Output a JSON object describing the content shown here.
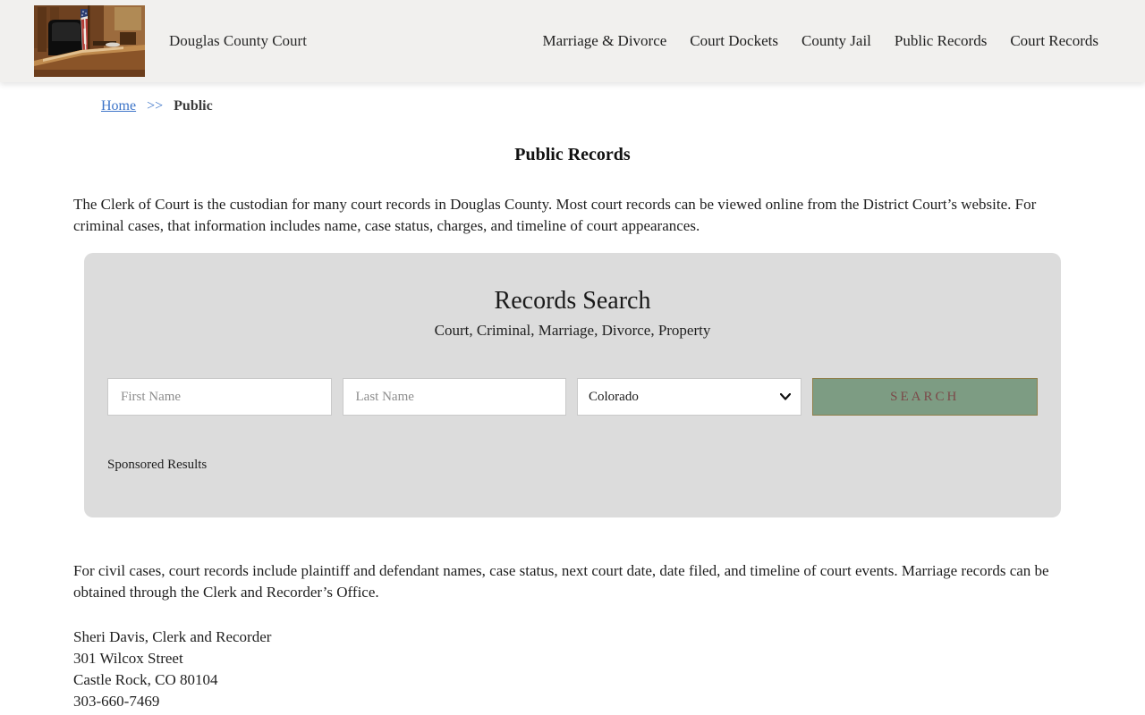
{
  "header": {
    "site_title": "Douglas County Court",
    "nav": [
      {
        "label": "Marriage & Divorce"
      },
      {
        "label": "Court Dockets"
      },
      {
        "label": "County Jail"
      },
      {
        "label": "Public Records"
      },
      {
        "label": "Court Records"
      }
    ]
  },
  "breadcrumb": {
    "home": "Home",
    "separator": ">>",
    "current": "Public"
  },
  "page": {
    "title": "Public Records",
    "intro": "The Clerk of Court is the custodian for many court records in Douglas County. Most court records can be viewed online from the District Court’s website. For criminal cases, that information includes name, case status, charges, and timeline of court appearances.",
    "civil_text": "For civil cases, court records include plaintiff and defendant names, case status, next court date, date filed, and timeline of court events. Marriage records can be obtained through the Clerk and Recorder’s Office.",
    "contact": {
      "name": "Sheri Davis, Clerk and Recorder",
      "street": "301 Wilcox Street",
      "city": "Castle Rock, CO 80104",
      "phone": "303-660-7469"
    }
  },
  "search_panel": {
    "title": "Records Search",
    "subtitle": "Court, Criminal, Marriage, Divorce, Property",
    "first_name_placeholder": "First Name",
    "last_name_placeholder": "Last Name",
    "state_selected": "Colorado",
    "search_label": "SEARCH",
    "sponsored_label": "Sponsored Results"
  },
  "colors": {
    "header_bg": "#f1f0ee",
    "panel_gray": "#dcdcdc",
    "button_green": "#7d9c83",
    "button_text_maroon": "#7b4949",
    "link_blue": "#3c74c8"
  }
}
